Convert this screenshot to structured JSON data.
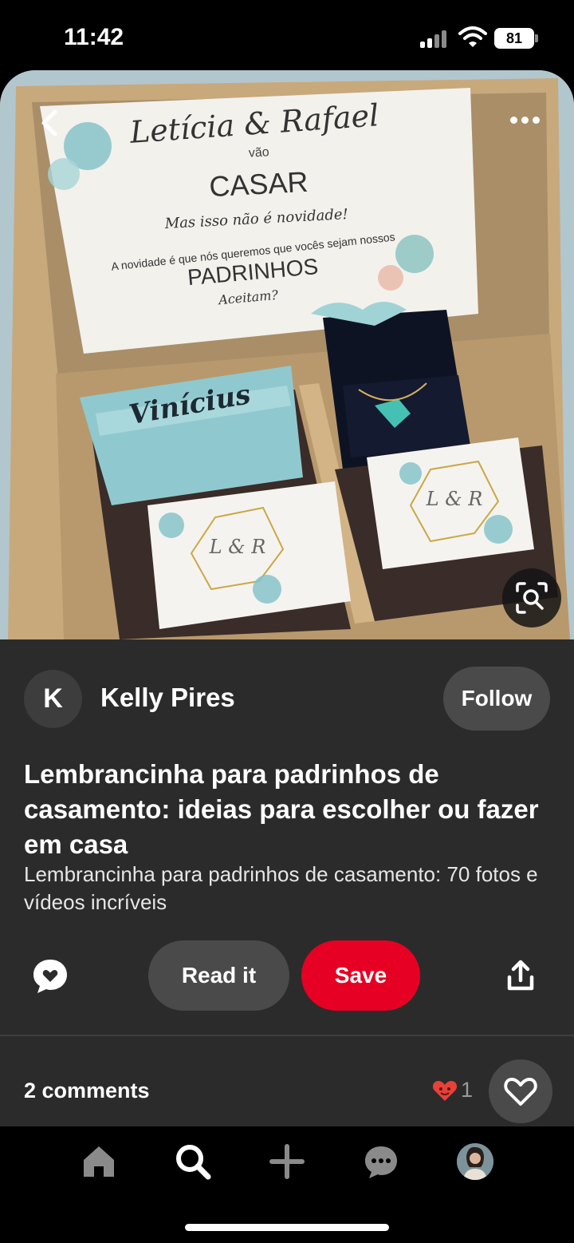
{
  "status_bar": {
    "time": "11:42",
    "battery": "81",
    "icons": [
      "signal-icon",
      "wifi-icon",
      "battery-icon"
    ]
  },
  "pin": {
    "image_text": {
      "names": "Letícia & Rafael",
      "line_vao": "vão",
      "line_casar": "CASAR",
      "line_novidade": "Mas isso não é novidade!",
      "line_explain": "A novidade é que nós queremos que vocês sejam nossos",
      "line_padrinhos": "PADRINHOS",
      "line_aceitam": "Aceitam?",
      "ribbon_name": "Vinícius",
      "monogram": "L & R"
    },
    "author": {
      "initial": "K",
      "name": "Kelly Pires",
      "follow_label": "Follow"
    },
    "title": "Lembrancinha para padrinhos de casamento: ideias para escolher ou fazer em casa",
    "description": "Lembrancinha para padrinhos de casamento: 70 fotos e vídeos incríveis"
  },
  "actions": {
    "read_label": "Read it",
    "save_label": "Save",
    "icons": [
      "comment-icon",
      "share-icon"
    ]
  },
  "comments": {
    "label": "2 comments",
    "reaction_count": "1"
  },
  "tab_bar": {
    "items": [
      "home-icon",
      "search-icon",
      "create-icon",
      "messages-icon",
      "profile-avatar"
    ]
  },
  "colors": {
    "save_red": "#e60023",
    "panel_bg": "#2b2b2b",
    "button_gray": "#4a4a4a",
    "heart_red": "#e8413a"
  }
}
